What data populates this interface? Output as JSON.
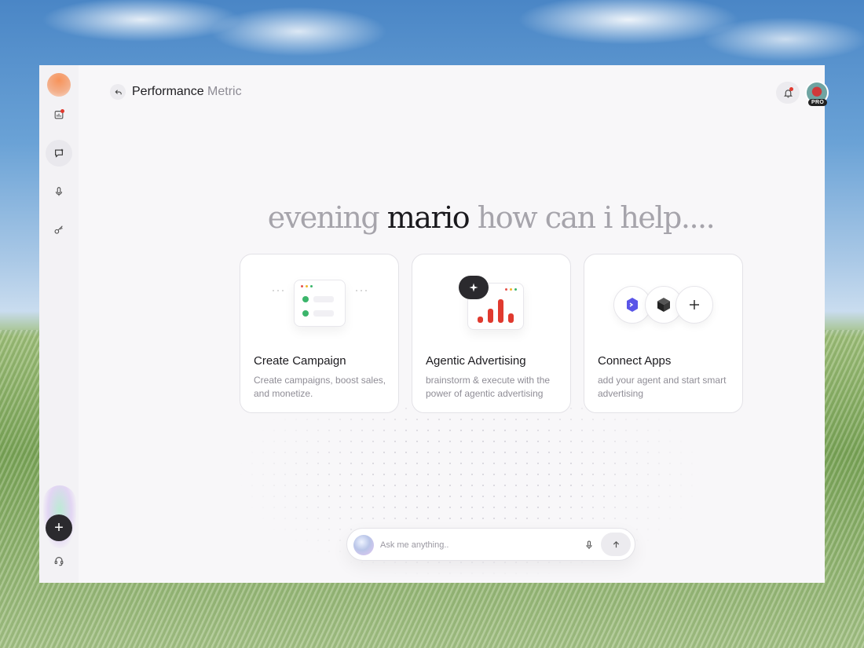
{
  "header": {
    "title_primary": "Performance",
    "title_secondary": "Metric",
    "pro_badge": "PRO"
  },
  "greeting": {
    "prefix": "evening",
    "name": "mario",
    "suffix": "how can i help...."
  },
  "cards": [
    {
      "title": "Create Campaign",
      "description": "Create campaigns, boost sales, and monetize."
    },
    {
      "title": "Agentic Advertising",
      "description": "brainstorm & execute with the power of agentic advertising"
    },
    {
      "title": "Connect Apps",
      "description": "add your agent and start smart advertising"
    }
  ],
  "chat": {
    "placeholder": "Ask me anything.."
  },
  "icons": {
    "sidebar": [
      "analytics-icon",
      "chat-icon",
      "microphone-icon",
      "key-icon",
      "plus-icon",
      "support-icon"
    ],
    "header": [
      "back-arrow-icon",
      "bell-icon"
    ],
    "card_apps": [
      "agent-app-icon",
      "cube-app-icon",
      "plus-icon"
    ],
    "chat": [
      "orb-icon",
      "microphone-icon",
      "arrow-up-icon"
    ]
  },
  "colors": {
    "accent_red": "#e03a2f",
    "check_green": "#3bb56b",
    "dark_button": "#2b2a2e",
    "greeting_muted": "#a6a4ab",
    "greeting_strong": "#1a191d"
  }
}
